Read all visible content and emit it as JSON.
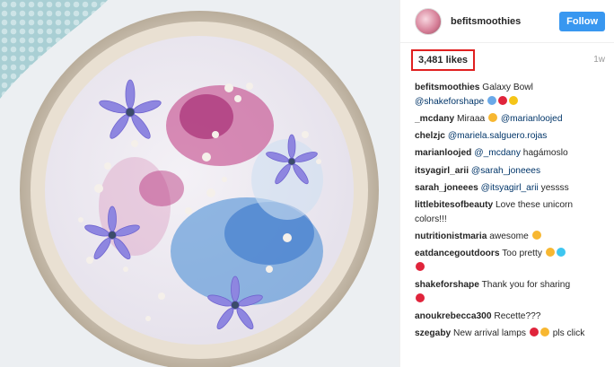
{
  "header": {
    "username": "befitsmoothies",
    "follow_label": "Follow"
  },
  "likes": "3,481 likes",
  "time_ago": "1w",
  "comments": [
    {
      "user": "befitsmoothies",
      "text": "Galaxy Bowl",
      "mention": "@shakeforshape",
      "emojis": [
        "butterfly",
        "red-heart",
        "sparkles"
      ]
    },
    {
      "user": "_mcdany",
      "text": "Miraaa",
      "emojis": [
        "heart-eyes"
      ],
      "mention": "@marianloojed"
    },
    {
      "user": "chelzjc",
      "mention": "@mariela.salguero.rojas"
    },
    {
      "user": "marianloojed",
      "mention": "@_mcdany",
      "text": "hagámoslo"
    },
    {
      "user": "itsyagirl_arii",
      "mention": "@sarah_joneees"
    },
    {
      "user": "sarah_joneees",
      "mention": "@itsyagirl_arii",
      "text": "yessss"
    },
    {
      "user": "littlebitesofbeauty",
      "text": "Love these unicorn colors!!!"
    },
    {
      "user": "nutritionistmaria",
      "text": "awesome",
      "emojis": [
        "ok-hand"
      ]
    },
    {
      "user": "eatdancegoutdoors",
      "text": "Too pretty",
      "emojis": [
        "heart-eyes",
        "blue-heart",
        "red-heart"
      ]
    },
    {
      "user": "shakeforshape",
      "text": "Thank you for sharing",
      "emojis": [
        "red-heart"
      ]
    },
    {
      "user": "anoukrebecca300",
      "text": "Recette???"
    },
    {
      "user": "szegaby",
      "text": "New arrival lamps",
      "text2": "pls click",
      "emojis": [
        "red-heart",
        "smirk"
      ]
    }
  ],
  "colors": {
    "follow_bg": "#3897f0",
    "highlight": "#e02020",
    "mention": "#003569"
  }
}
